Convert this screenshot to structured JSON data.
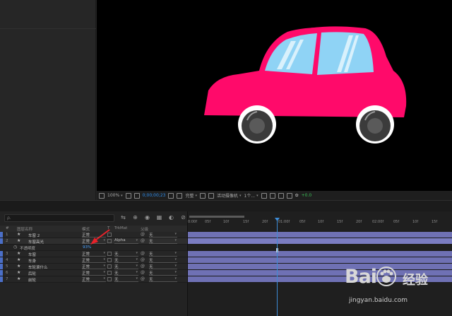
{
  "viewer_toolbar": {
    "zoom": "100%",
    "timecode": "0;00;00;23",
    "quality": "完整",
    "camera": "活动摄像机",
    "views": "1个...",
    "exposure": "+0.0"
  },
  "timeline": {
    "search_placeholder": "ρ.",
    "columns": {
      "hash": "#",
      "layer_name": "图层名称",
      "mode": "模式",
      "t": "T",
      "trkmat": "TrkMat",
      "parent": "父级"
    },
    "layers": [
      {
        "num": "1",
        "name": "车窗 2",
        "mode": "正常",
        "trkmat": "",
        "parent": "无",
        "selected": false
      },
      {
        "num": "2",
        "name": "车窗高光",
        "mode": "正常",
        "trkmat": "Alpha",
        "parent": "无",
        "selected": true
      },
      {
        "num": "",
        "name": "不透明度",
        "mode": "93%",
        "trkmat": "",
        "parent": "",
        "property": true
      },
      {
        "num": "3",
        "name": "车窗",
        "mode": "正常",
        "trkmat": "无",
        "parent": "无",
        "selected": false
      },
      {
        "num": "4",
        "name": "车身",
        "mode": "正常",
        "trkmat": "无",
        "parent": "无",
        "selected": false
      },
      {
        "num": "5",
        "name": "车轮滚什么",
        "mode": "正常",
        "trkmat": "无",
        "parent": "无",
        "selected": false
      },
      {
        "num": "6",
        "name": "后轮",
        "mode": "正常",
        "trkmat": "无",
        "parent": "无",
        "selected": false
      },
      {
        "num": "7",
        "name": "前轮",
        "mode": "正常",
        "trkmat": "无",
        "parent": "无",
        "selected": false
      }
    ],
    "ruler_labels": [
      "0:00f",
      "05f",
      "10f",
      "15f",
      "20f",
      "01:00f",
      "05f",
      "10f",
      "15f",
      "20f",
      "02:00f",
      "05f",
      "10f",
      "15f"
    ]
  },
  "watermark": {
    "brand": "Bai",
    "brand_suffix": "经验",
    "url": "jingyan.baidu.com"
  },
  "colors": {
    "car_body": "#ff0a6a",
    "window": "#8fd3f5",
    "layer_bar": "#6f71b4",
    "playhead": "#3d8cd6",
    "label_blue": "#4b6fc8"
  }
}
